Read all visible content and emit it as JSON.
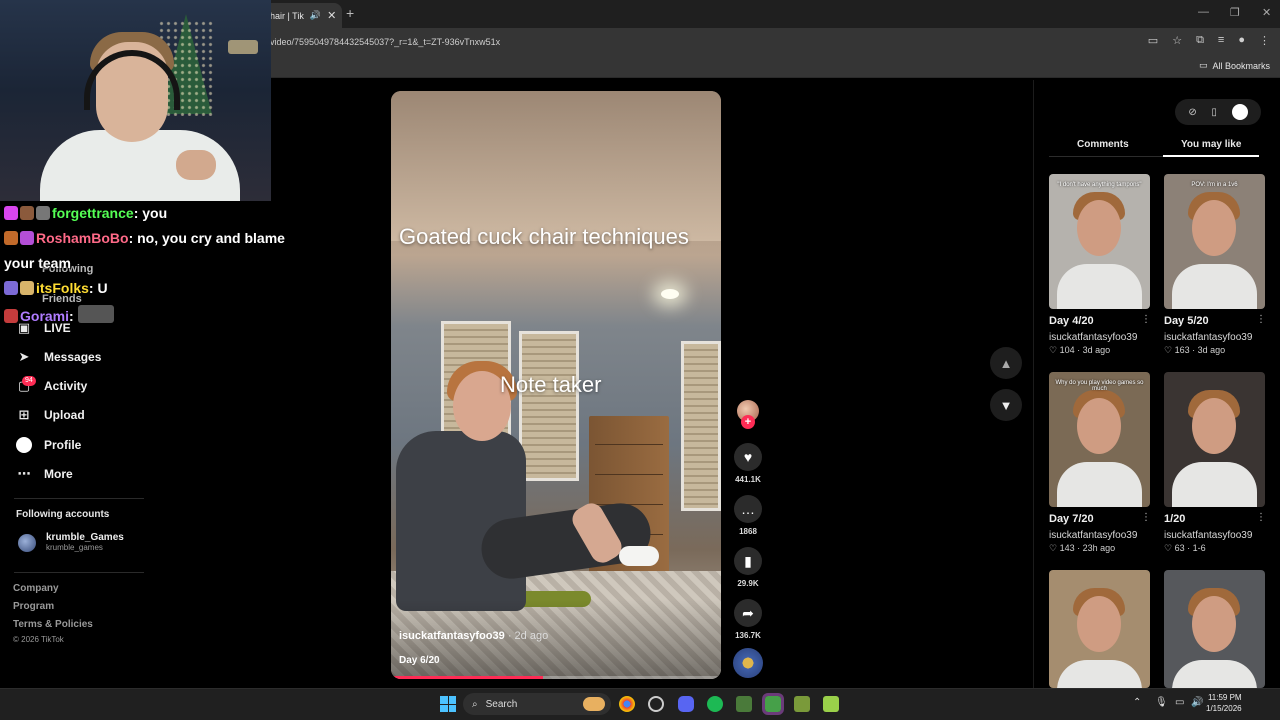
{
  "browser": {
    "tab_title": "hair | Tik",
    "new_tab_symbol": "+",
    "url": "video/7595049784432545037?_r=1&_t=ZT-936vTnxw51x",
    "bookmarks_label": "All Bookmarks",
    "window_controls": [
      "—",
      "❐",
      "✕"
    ]
  },
  "chat": [
    {
      "user": "forgettrance",
      "user_color": "#55ff55",
      "message": "you"
    },
    {
      "user": "RoshamBoBo",
      "user_color": "#ff6a88",
      "message": "no, you cry and blame"
    },
    {
      "user": "",
      "user_color": "#ffffff",
      "message": "your team"
    },
    {
      "user": "itsFolks",
      "user_color": "#ffdd33",
      "message": "U"
    },
    {
      "user": "Gorami",
      "user_color": "#b07cff",
      "message": ""
    }
  ],
  "sidebar": {
    "partial_items": [
      "Following",
      "Friends"
    ],
    "items": [
      {
        "label": "LIVE",
        "icon": "live-icon"
      },
      {
        "label": "Messages",
        "icon": "messages-icon"
      },
      {
        "label": "Activity",
        "icon": "activity-icon",
        "badge": "94"
      },
      {
        "label": "Upload",
        "icon": "upload-icon"
      },
      {
        "label": "Profile",
        "icon": "profile-icon"
      },
      {
        "label": "More",
        "icon": "more-icon"
      }
    ],
    "following_header": "Following accounts",
    "following": [
      {
        "name": "krumble_Games",
        "handle": "krumble_games"
      }
    ],
    "footer": [
      "Company",
      "Program",
      "Terms & Policies"
    ],
    "copyright": "© 2026 TikTok"
  },
  "video": {
    "caption_top": "Goated cuck chair techniques",
    "caption_mid": "Note taker",
    "author": "isuckatfantasyfoo39",
    "posted": "· 2d ago",
    "description": "Day 6/20",
    "progress": 0.46
  },
  "actions": {
    "likes": "441.1K",
    "comments": "1868",
    "saves": "29.9K",
    "shares": "136.7K"
  },
  "right_panel": {
    "tabs": [
      "Comments",
      "You may like"
    ],
    "active_tab": "You may like",
    "cards": [
      {
        "title": "Day 4/20",
        "user": "isuckatfantasyfoo39",
        "likes": "104",
        "time": "3d ago",
        "overlay": "\"I don't have anything tampons\"",
        "bg": "#b5b2ad"
      },
      {
        "title": "Day 5/20",
        "user": "isuckatfantasyfoo39",
        "likes": "163",
        "time": "3d ago",
        "overlay": "POV: I'm in a 1v6",
        "bg": "#8c8177"
      },
      {
        "title": "Day 7/20",
        "user": "isuckatfantasyfoo39",
        "likes": "143",
        "time": "23h ago",
        "overlay": "Why do you play video games so much",
        "bg": "#7b6a55"
      },
      {
        "title": "1/20",
        "user": "isuckatfantasyfoo39",
        "likes": "63",
        "time": "1-6",
        "overlay": "",
        "bg": "#3a3432"
      },
      {
        "title": "",
        "user": "",
        "likes": "",
        "time": "",
        "overlay": "",
        "bg": "#a58d6f"
      },
      {
        "title": "",
        "user": "",
        "likes": "",
        "time": "",
        "overlay": "",
        "bg": "#56585c"
      }
    ]
  },
  "taskbar": {
    "search_label": "Search",
    "time": "11:59 PM",
    "date": "1/15/2026"
  }
}
